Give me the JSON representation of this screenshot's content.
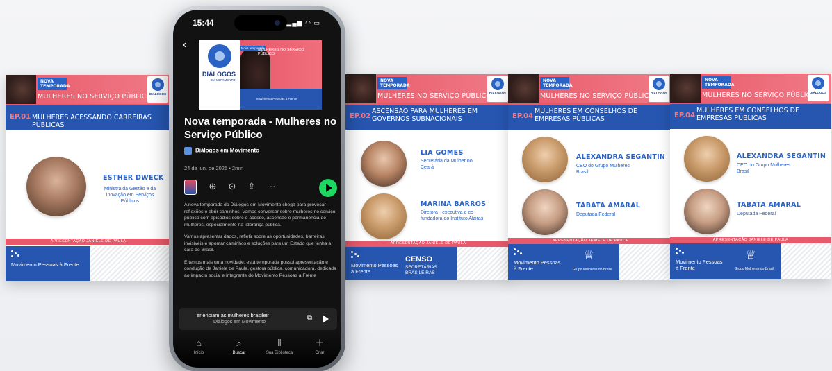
{
  "brand": {
    "new_season_tag": "NOVA TEMPORADA",
    "series": "MULHERES NO SERVIÇO PÚBLICO",
    "logo_name": "DIÁLOGOS",
    "logo_sub": "EM MOVIMENTO",
    "presentation": "APRESENTAÇÃO JANIELE DE PAULA",
    "partner_label": "Movimento Pessoas à Frente"
  },
  "cards": [
    {
      "episode": "EP.01",
      "title": "MULHERES ACESSANDO CARREIRAS PÚBLICAS",
      "guests": [
        {
          "name": "ESTHER DWECK",
          "role": "Ministra da Gestão e da Inovação em Serviços Públicos"
        }
      ]
    },
    {
      "episode": "EP.02",
      "title": "ASCENSÃO PARA MULHERES EM GOVERNOS SUBNACIONAIS",
      "guests": [
        {
          "name": "LIA GOMES",
          "role": "Secretária da Mulher no Ceará"
        },
        {
          "name": "MARINA BARROS",
          "role": "Diretora - executiva e co-fundadora do Instituto Alziras"
        }
      ],
      "partner": {
        "title": "CENSO",
        "sub": "SECRETÁRIAS BRASILEIRAS"
      }
    },
    {
      "episode": "EP.04",
      "title": "MULHERES EM CONSELHOS DE EMPRESAS PÚBLICAS",
      "guests": [
        {
          "name": "ALEXANDRA SEGANTIN",
          "role": "CEO do Grupo Mulheres Brasil"
        },
        {
          "name": "TABATA AMARAL",
          "role": "Deputada Federal"
        }
      ],
      "partner": {
        "title": "Grupo Mulheres do Brasil"
      }
    },
    {
      "episode": "EP.04",
      "title": "MULHERES EM CONSELHOS DE EMPRESAS PÚBLICAS",
      "guests": [
        {
          "name": "ALEXANDRA SEGANTIN",
          "role": "CEO do Grupo Mulheres Brasil"
        },
        {
          "name": "TABATA AMARAL",
          "role": "Deputada Federal"
        }
      ],
      "partner": {
        "title": "Grupo Mulheres do Brasil"
      }
    }
  ],
  "phone": {
    "time": "15:44",
    "status_icons": "signal wifi battery",
    "cover_tag": "Nova temporada",
    "cover_series": "MULHERES NO SERVIÇO PÚBLICO",
    "cover_partner": "Movimento Pessoas à Frente",
    "episode_title": "Nova temporada - Mulheres no Serviço Público",
    "show_name": "Diálogos em Movimento",
    "meta": "24 de jun. de 2025 • 2min",
    "description": [
      "A nova temporada do Diálogos em Movimento chega para provocar reflexões e abrir caminhos. Vamos conversar sobre mulheres no serviço público com episódios sobre o acesso, ascensão e permanência de mulheres, especialmente na liderança pública.",
      "Vamos apresentar dados, refletir sobre as oportunidades, barreiras invisíveis e apontar caminhos e soluções para um Estado que tenha a cara do Brasil.",
      "E temos mais uma novidade: está temporada possui apresentação e condução de Janiele de Paula, gestora pública, comunicadora, dedicada ao impacto social e integrante do Movimento Pessoas à Frente"
    ],
    "mini_player": {
      "title": "erienciam as mulheres brasileir",
      "show": "Diálogos em Movimento"
    },
    "nav": [
      {
        "label": "Início",
        "icon": "home-icon"
      },
      {
        "label": "Buscar",
        "icon": "search-icon"
      },
      {
        "label": "Sua Biblioteca",
        "icon": "library-icon"
      },
      {
        "label": "Criar",
        "icon": "plus-icon"
      }
    ]
  },
  "colors": {
    "coral": "#e85a6b",
    "blue": "#2656b0",
    "green": "#1ed760"
  }
}
